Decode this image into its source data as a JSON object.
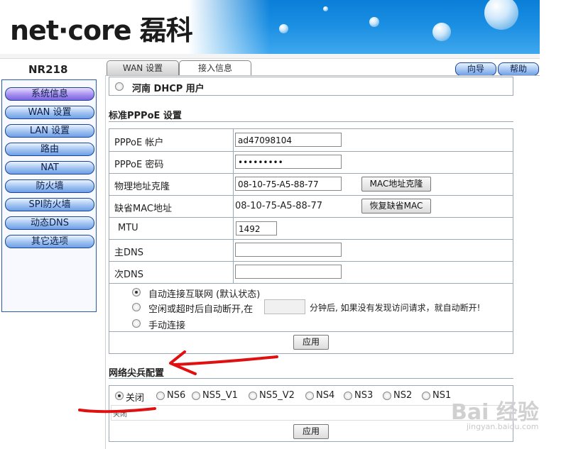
{
  "header": {
    "logo": "net·core 磊科"
  },
  "sidebar": {
    "model": "NR218",
    "items": [
      {
        "label": "系统信息"
      },
      {
        "label": "WAN 设置"
      },
      {
        "label": "LAN 设置"
      },
      {
        "label": "路由"
      },
      {
        "label": "NAT"
      },
      {
        "label": "防火墙"
      },
      {
        "label": "SPI防火墙"
      },
      {
        "label": "动态DNS"
      },
      {
        "label": "其它选项"
      }
    ]
  },
  "tabs": [
    {
      "label": "WAN 设置"
    },
    {
      "label": "接入信息"
    }
  ],
  "top_buttons": {
    "wizard": "向导",
    "help": "帮助"
  },
  "henan_option": {
    "label": "河南 DHCP 用户"
  },
  "pppoe": {
    "title": "标准PPPoE 设置",
    "account_label": "PPPoE 帐户",
    "account_value": "ad47098104",
    "password_label": "PPPoE 密码",
    "password_value": "•••••••••",
    "clone_label": "物理地址克隆",
    "clone_value": "08-10-75-A5-88-77",
    "clone_button": "MAC地址克隆",
    "default_mac_label": "缺省MAC地址",
    "default_mac_value": "08-10-75-A5-88-77",
    "restore_button": "恢复缺省MAC",
    "mtu_label": "MTU",
    "mtu_value": "1492",
    "dns1_label": "主DNS",
    "dns1_value": "",
    "dns2_label": "次DNS",
    "dns2_value": "",
    "connect_auto": "自动连接互联网 (默认状态)",
    "connect_idle_prefix": "空闲或超时后自动断开,在",
    "connect_idle_suffix": "分钟后, 如果没有发现访问请求，就自动断开!",
    "connect_manual": "手动连接",
    "apply": "应用"
  },
  "sentinel": {
    "title": "网络尖兵配置",
    "options": [
      "关闭",
      "NS6",
      "NS5_V1",
      "NS5_V2",
      "NS4",
      "NS3",
      "NS2",
      "NS1"
    ],
    "selected": "关闭",
    "status": "关闭",
    "apply": "应用"
  },
  "watermark": {
    "main": "Bai 经验",
    "sub": "jingyan.baidu.com"
  }
}
